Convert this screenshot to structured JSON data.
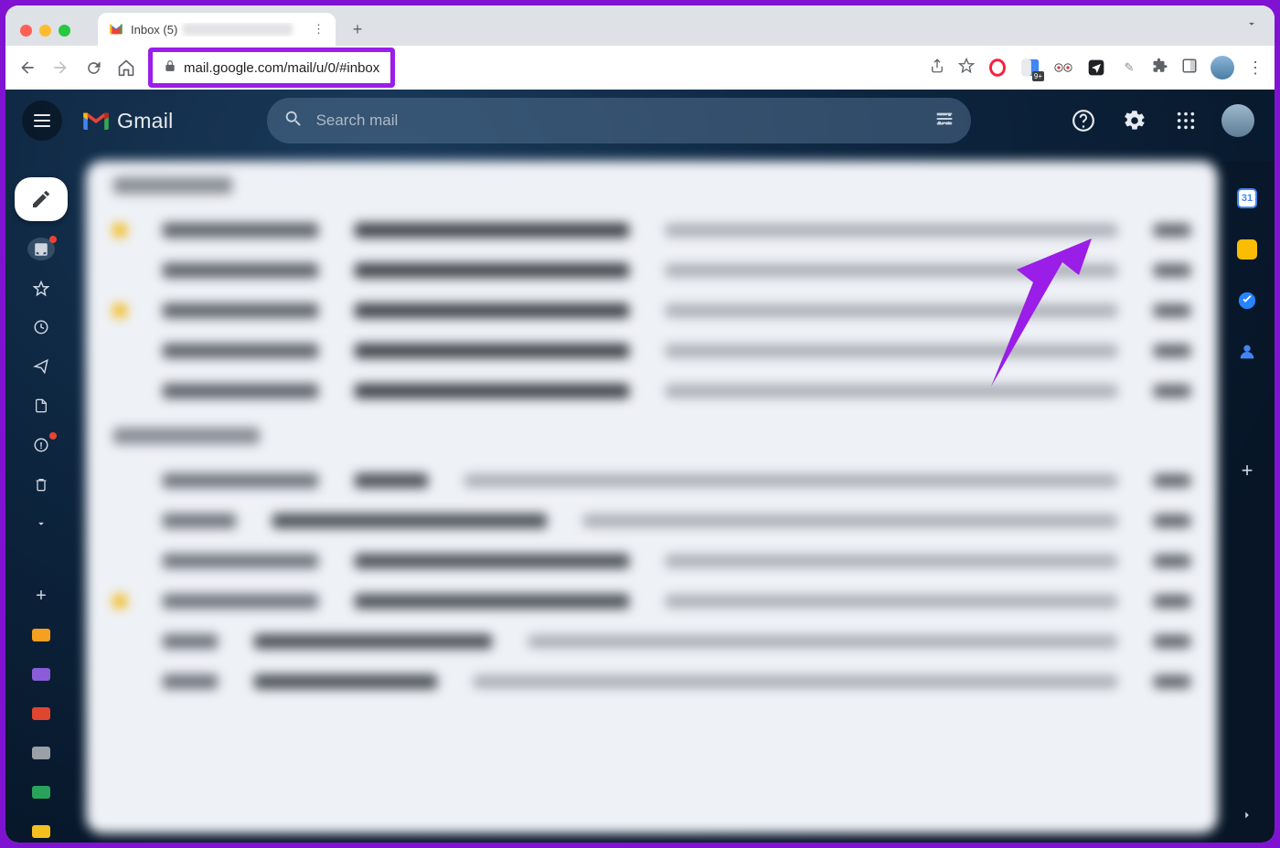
{
  "browser": {
    "tab_title": "Inbox (5)",
    "url": "mail.google.com/mail/u/0/#inbox"
  },
  "gmail": {
    "product_name": "Gmail",
    "search_placeholder": "Search mail"
  },
  "right_side_panel": {
    "calendar_day": "31"
  },
  "annotation": {
    "arrow_color": "#9a1de8",
    "highlight_color": "#9a1de8"
  }
}
